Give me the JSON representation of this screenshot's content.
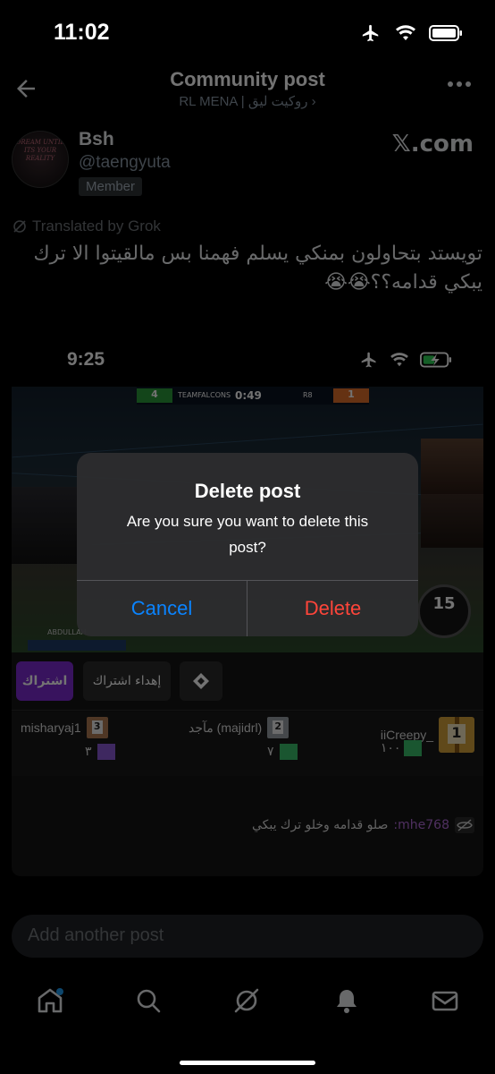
{
  "status_bar": {
    "time": "11:02"
  },
  "header": {
    "title": "Community post",
    "subtitle": "RL MENA | روكيت ليق ›"
  },
  "author": {
    "avatar_text": "DREAM UNTIL ITS YOUR REALITY",
    "name": "Bsh",
    "handle": "@taengyuta",
    "badge": "Member"
  },
  "watermark": "𝕏.com",
  "post": {
    "translated_label": "Translated by Grok",
    "text": "تويستد بتحاولون بمنكي يسلم فهمنا بس مالقيتوا الا ترك يبكي قدامه؟؟😭😭"
  },
  "screenshot": {
    "time": "9:25",
    "hud": {
      "score_left": "4",
      "score_right": "1",
      "clock": "0:49",
      "team_left": "TEAMFALCONS",
      "team_right": "R8",
      "player": "ABDULLAH",
      "boost": "15"
    }
  },
  "dialog": {
    "title": "Delete post",
    "message": "Are you sure you want to delete this post?",
    "cancel": "Cancel",
    "delete": "Delete"
  },
  "kick": {
    "subscribe": "اشتراك",
    "gift_sub": "إهداء اشتراك",
    "top_gifters": [
      {
        "rank": "1",
        "name": "iiCreepy_",
        "count": "١٠٠"
      },
      {
        "rank": "2",
        "name": "مآجد (majidrl)",
        "count": "٧"
      },
      {
        "rank": "3",
        "name": "misharyaj1",
        "count": "٣"
      }
    ],
    "chat": {
      "user": "mhe768:",
      "message": "صلو قدامه وخلو ترك يبكي"
    }
  },
  "compose": {
    "placeholder": "Add another post"
  },
  "colors": {
    "cancel": "#0a84ff",
    "delete": "#ff453a",
    "kick_purple": "#7d2ad0",
    "notification_dot": "#1d9bf0"
  }
}
